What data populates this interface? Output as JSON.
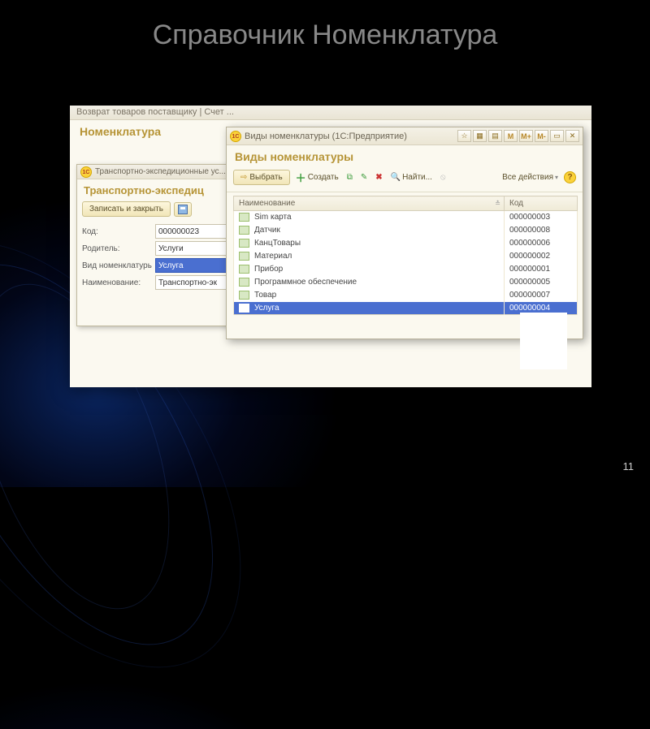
{
  "slide": {
    "title": "Справочник Номенклатура",
    "page": "11"
  },
  "bg_header": "Возврат товаров поставщику    |    Счет ...",
  "nomenclature_title": "Номенклатура",
  "form": {
    "titlebar": "Транспортно-экспедиционные ус...",
    "header": "Транспортно-экспедиц",
    "save_close": "Записать и закрыть",
    "rows": {
      "code_label": "Код:",
      "code_value": "000000023",
      "parent_label": "Родитель:",
      "parent_value": "Услуги",
      "kind_label": "Вид номенклатуры:",
      "kind_value": "Услуга",
      "name_label": "Наименование:",
      "name_value": "Транспортно-эк"
    }
  },
  "list": {
    "titlebar": "Виды номенклатуры  (1С:Предприятие)",
    "titlebar_markers": {
      "m": "M",
      "mplus": "M+",
      "mminus": "M-"
    },
    "header": "Виды номенклатуры",
    "toolbar": {
      "choose": "Выбрать",
      "create": "Создать",
      "find": "Найти...",
      "all_actions": "Все действия"
    },
    "columns": {
      "name": "Наименование",
      "code": "Код"
    },
    "rows": [
      {
        "name": "Sim карта",
        "code": "000000003"
      },
      {
        "name": "Датчик",
        "code": "000000008"
      },
      {
        "name": "КанцТовары",
        "code": "000000006"
      },
      {
        "name": "Материал",
        "code": "000000002"
      },
      {
        "name": "Прибор",
        "code": "000000001"
      },
      {
        "name": "Программное обеспечение",
        "code": "000000005"
      },
      {
        "name": "Товар",
        "code": "000000007"
      },
      {
        "name": "Услуга",
        "code": "000000004"
      }
    ],
    "selected_index": 7
  }
}
